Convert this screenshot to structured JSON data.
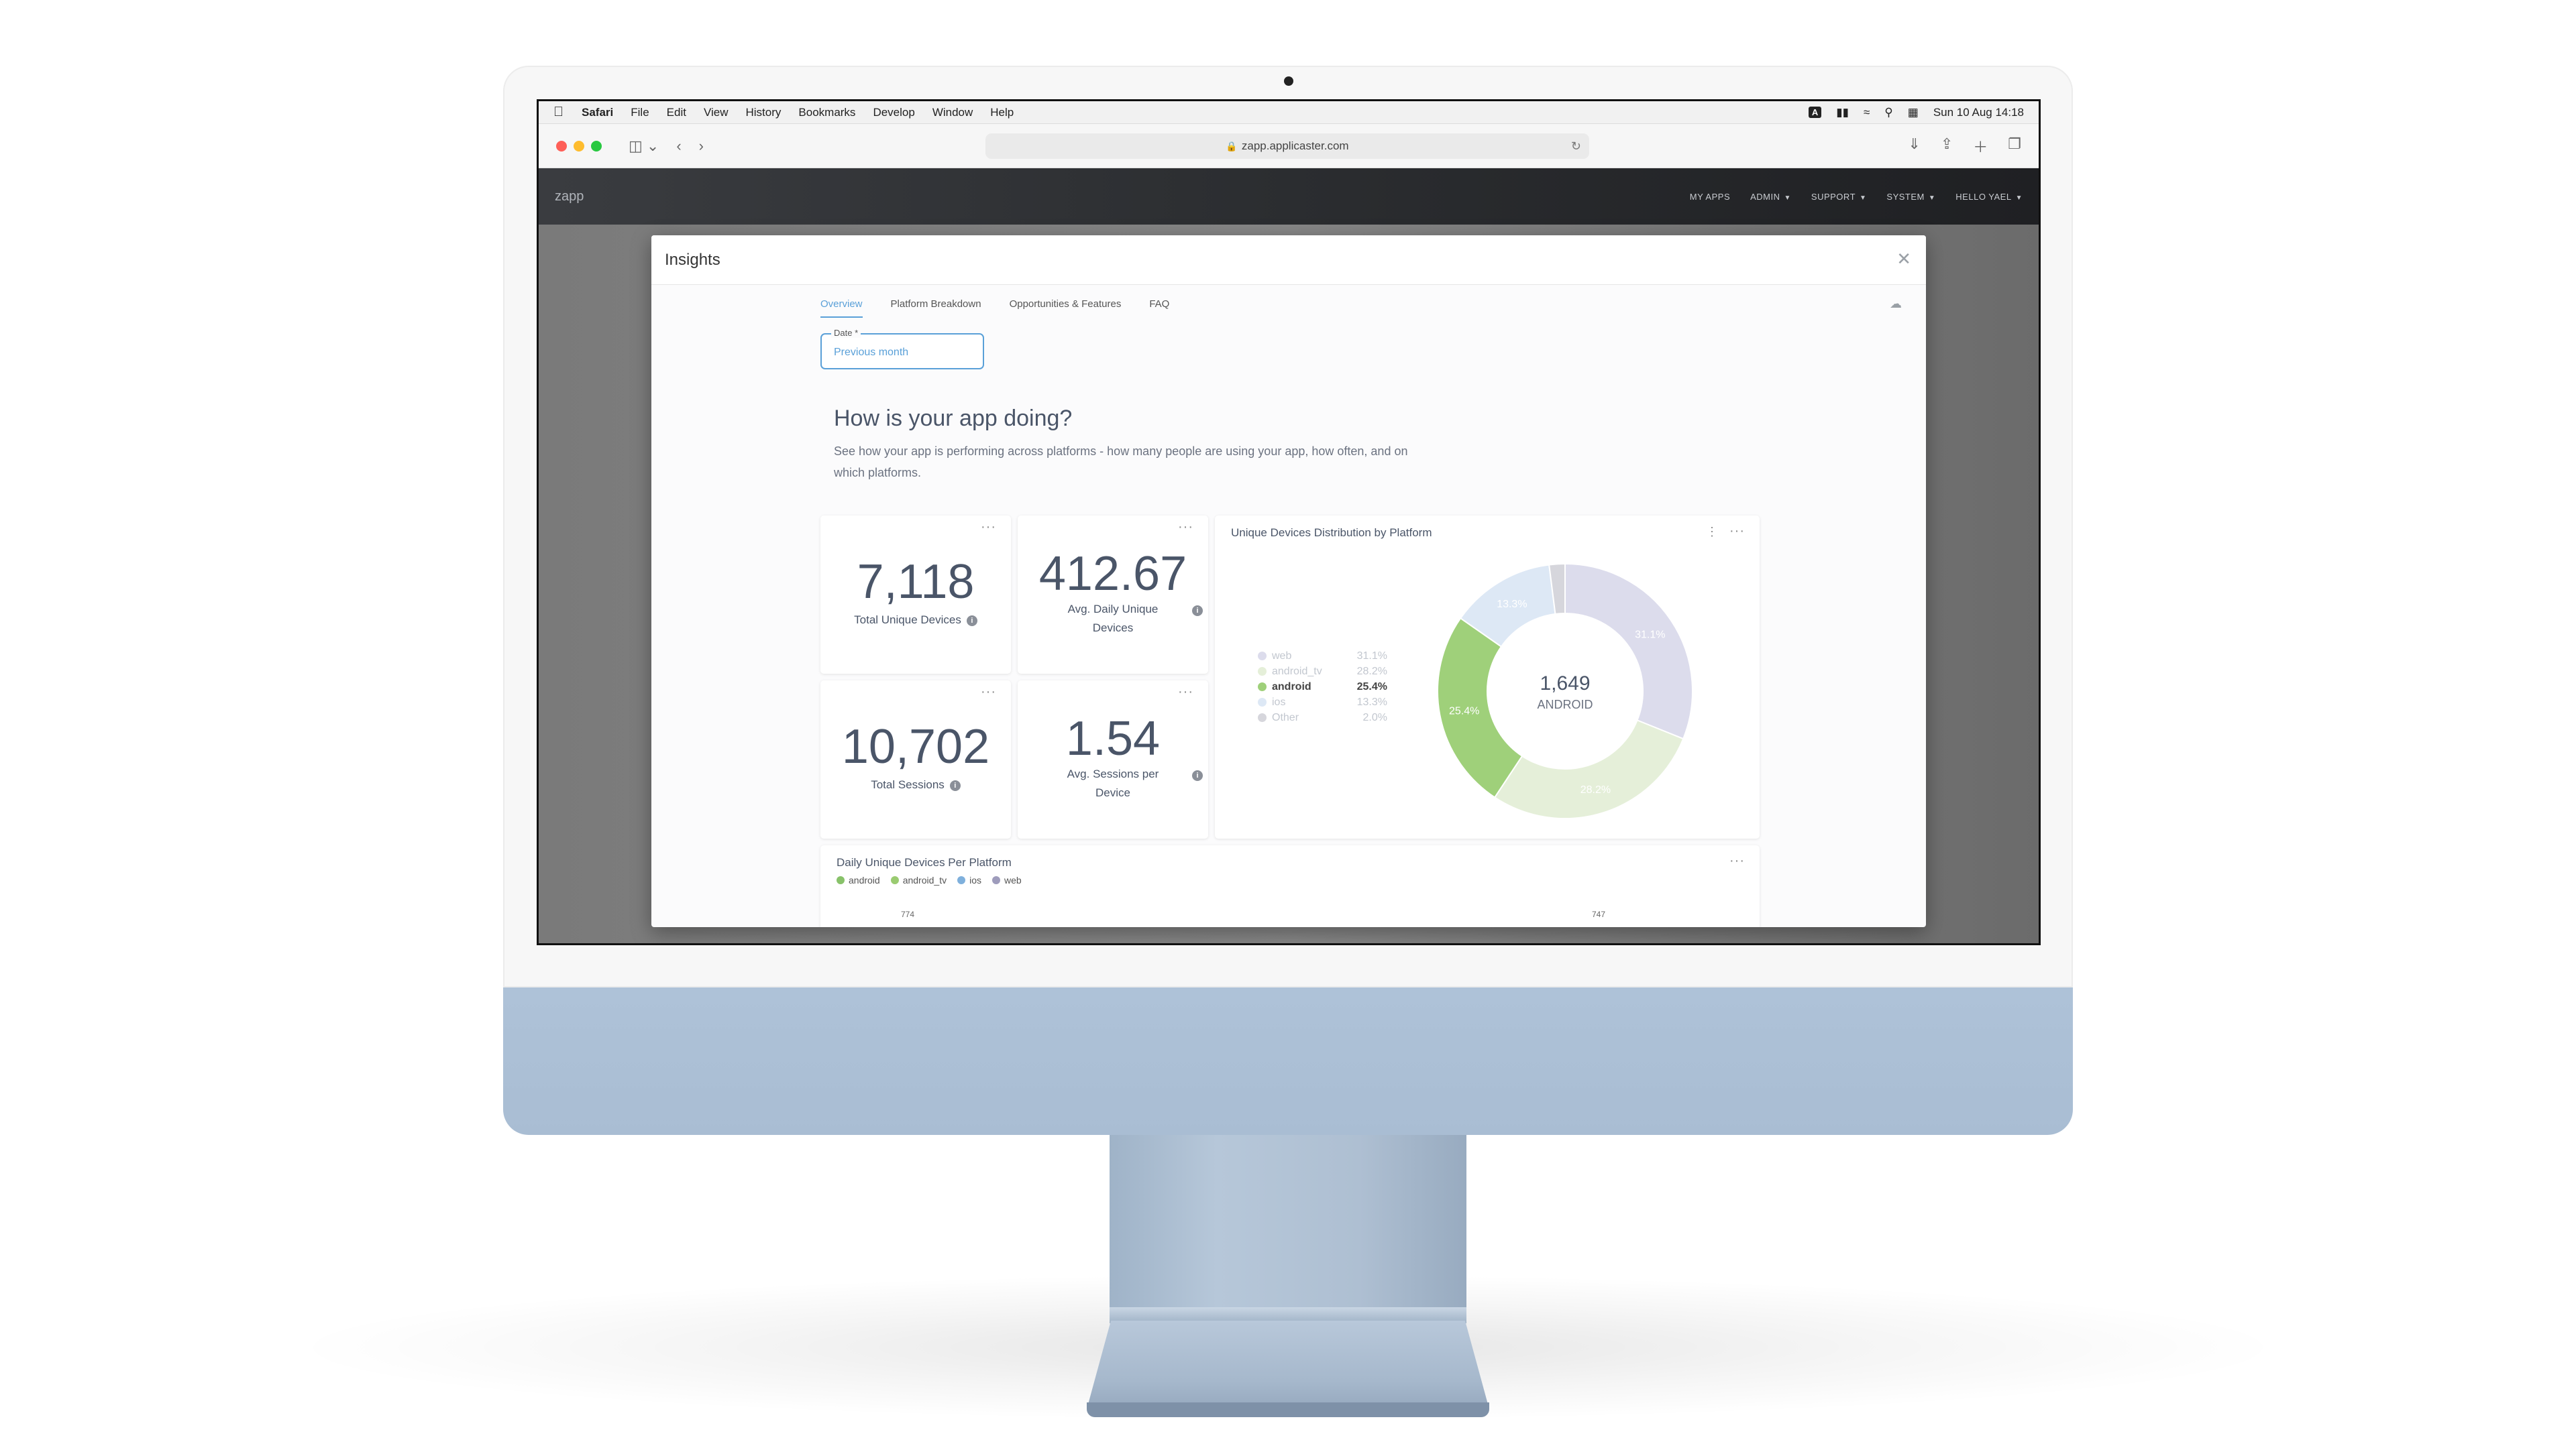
{
  "menubar": {
    "items": [
      "Safari",
      "File",
      "Edit",
      "View",
      "History",
      "Bookmarks",
      "Develop",
      "Window",
      "Help"
    ],
    "input_badge": "A",
    "clock": "Sun 10 Aug  14:18"
  },
  "browser": {
    "url": "zapp.applicaster.com"
  },
  "app": {
    "logo": "zapp",
    "nav": [
      "MY APPS",
      "ADMIN",
      "SUPPORT",
      "SYSTEM",
      "HELLO YAEL"
    ]
  },
  "modal": {
    "title": "Insights",
    "tabs": [
      "Overview",
      "Platform Breakdown",
      "Opportunities & Features",
      "FAQ"
    ],
    "date_field": {
      "label": "Date *",
      "value": "Previous month"
    },
    "heading": "How is your app doing?",
    "subtext": "See how your app is performing across platforms - how many people are using your app, how often, and on which platforms."
  },
  "stats": [
    {
      "value": "7,118",
      "label": "Total Unique Devices"
    },
    {
      "value": "412.67",
      "label_line1": "Avg. Daily Unique",
      "label_line2": "Devices"
    },
    {
      "value": "10,702",
      "label": "Total Sessions"
    },
    {
      "value": "1.54",
      "label_line1": "Avg. Sessions per",
      "label_line2": "Device"
    }
  ],
  "donut_card": {
    "title": "Unique Devices Distribution by Platform",
    "center_value": "1,649",
    "center_label": "ANDROID"
  },
  "chart_data": {
    "type": "pie",
    "title": "Unique Devices Distribution by Platform",
    "slices": [
      {
        "name": "web",
        "value": 31.1,
        "label": "31.1%",
        "color": "#dcdcec"
      },
      {
        "name": "android_tv",
        "value": 28.2,
        "label": "28.2%",
        "color": "#e5efd9"
      },
      {
        "name": "android",
        "value": 25.4,
        "label": "25.4%",
        "color": "#9fd07a",
        "highlighted": true
      },
      {
        "name": "ios",
        "value": 13.3,
        "label": "13.3%",
        "color": "#dde8f5"
      },
      {
        "name": "Other",
        "value": 2.0,
        "label": "2.0%",
        "color": "#d6d6dc"
      }
    ],
    "legend_placement": "left"
  },
  "line_card": {
    "title": "Daily Unique Devices Per Platform",
    "legend": [
      {
        "name": "android",
        "color": "#88c26a"
      },
      {
        "name": "android_tv",
        "color": "#9acb71"
      },
      {
        "name": "ios",
        "color": "#7fb0dc"
      },
      {
        "name": "web",
        "color": "#9e9cbc"
      }
    ],
    "visible_ticks": [
      "774",
      "747"
    ]
  },
  "colors": {
    "accent": "#5aa0d8",
    "text": "#4a5568"
  },
  "icons": [
    "apple-icon",
    "lock-icon",
    "reload-icon",
    "close-icon",
    "cloud-icon",
    "info-icon",
    "more-dots-icon"
  ]
}
